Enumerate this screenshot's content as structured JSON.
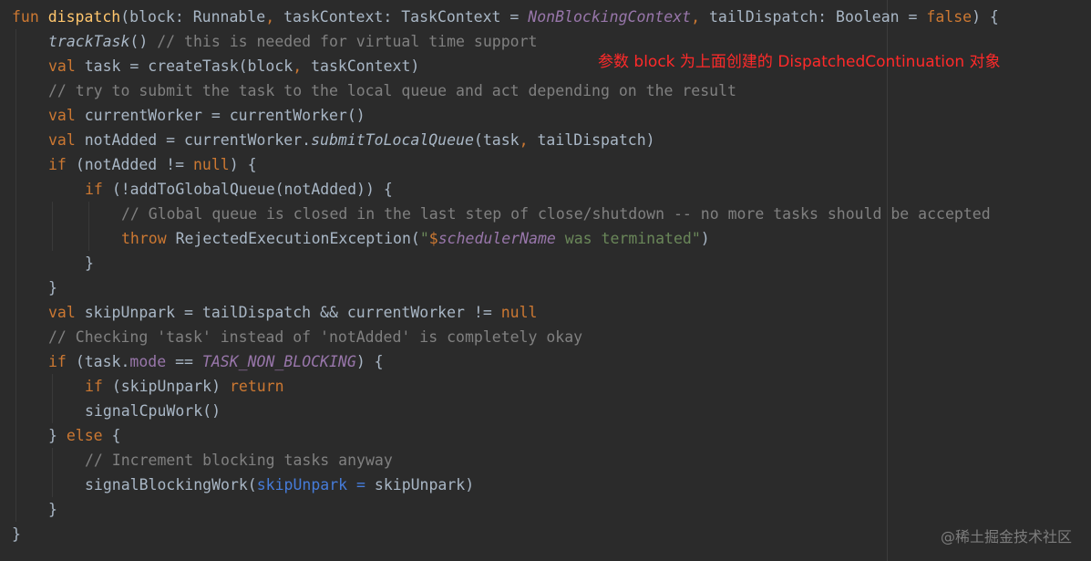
{
  "annotation": "参数 block 为上面创建的 DispatchedContinuation 对象",
  "watermark": "@稀土掘金技术社区",
  "colors": {
    "background": "#2b2b2b",
    "keyword": "#cc7832",
    "function_decl": "#ffc66d",
    "default_text": "#a9b7c6",
    "comment": "#808080",
    "string": "#6a8759",
    "static_constant": "#9876aa",
    "named_argument": "#467cda",
    "annotation_text": "#ff2a2a",
    "watermark": "#7d7d7d"
  },
  "code_lines": [
    {
      "indent": 0,
      "tokens": [
        {
          "t": "fun",
          "c": "kw"
        },
        {
          "t": " ",
          "c": "pl"
        },
        {
          "t": "dispatch",
          "c": "fn"
        },
        {
          "t": "(block: Runnable",
          "c": "pl"
        },
        {
          "t": ", ",
          "c": "kw"
        },
        {
          "t": "taskContext: TaskContext = ",
          "c": "pl"
        },
        {
          "t": "NonBlockingContext",
          "c": "st"
        },
        {
          "t": ", ",
          "c": "kw"
        },
        {
          "t": "tailDispatch: Boolean = ",
          "c": "pl"
        },
        {
          "t": "false",
          "c": "kw"
        },
        {
          "t": ") {",
          "c": "pl"
        }
      ]
    },
    {
      "indent": 1,
      "tokens": [
        {
          "t": "trackTask",
          "c": "it"
        },
        {
          "t": "() ",
          "c": "pl"
        },
        {
          "t": "// this is needed for virtual time support",
          "c": "cm"
        }
      ]
    },
    {
      "indent": 1,
      "tokens": [
        {
          "t": "val ",
          "c": "kw"
        },
        {
          "t": "task = createTask(block",
          "c": "pl"
        },
        {
          "t": ", ",
          "c": "kw"
        },
        {
          "t": "taskContext)",
          "c": "pl"
        }
      ]
    },
    {
      "indent": 1,
      "tokens": [
        {
          "t": "// try to submit the task to the local queue and act depending on the result",
          "c": "cm"
        }
      ]
    },
    {
      "indent": 1,
      "tokens": [
        {
          "t": "val ",
          "c": "kw"
        },
        {
          "t": "currentWorker = currentWorker()",
          "c": "pl"
        }
      ]
    },
    {
      "indent": 1,
      "tokens": [
        {
          "t": "val ",
          "c": "kw"
        },
        {
          "t": "notAdded = currentWorker.",
          "c": "pl"
        },
        {
          "t": "submitToLocalQueue",
          "c": "it"
        },
        {
          "t": "(task",
          "c": "pl"
        },
        {
          "t": ", ",
          "c": "kw"
        },
        {
          "t": "tailDispatch)",
          "c": "pl"
        }
      ]
    },
    {
      "indent": 1,
      "tokens": [
        {
          "t": "if ",
          "c": "kw"
        },
        {
          "t": "(notAdded != ",
          "c": "pl"
        },
        {
          "t": "null",
          "c": "kw"
        },
        {
          "t": ") {",
          "c": "pl"
        }
      ]
    },
    {
      "indent": 2,
      "tokens": [
        {
          "t": "if ",
          "c": "kw"
        },
        {
          "t": "(!addToGlobalQueue(notAdded)) {",
          "c": "pl"
        }
      ]
    },
    {
      "indent": 3,
      "tokens": [
        {
          "t": "// Global queue is closed in the last step of close/shutdown -- no more tasks should be accepted",
          "c": "cm"
        }
      ]
    },
    {
      "indent": 3,
      "tokens": [
        {
          "t": "throw ",
          "c": "kw"
        },
        {
          "t": "RejectedExecutionException(",
          "c": "pl"
        },
        {
          "t": "\"",
          "c": "sg"
        },
        {
          "t": "$",
          "c": "kw"
        },
        {
          "t": "schedulerName",
          "c": "st"
        },
        {
          "t": " was terminated\"",
          "c": "sg"
        },
        {
          "t": ")",
          "c": "pl"
        }
      ]
    },
    {
      "indent": 2,
      "tokens": [
        {
          "t": "}",
          "c": "pl"
        }
      ]
    },
    {
      "indent": 1,
      "tokens": [
        {
          "t": "}",
          "c": "pl"
        }
      ]
    },
    {
      "indent": 1,
      "tokens": [
        {
          "t": "val ",
          "c": "kw"
        },
        {
          "t": "skipUnpark = tailDispatch && currentWorker != ",
          "c": "pl"
        },
        {
          "t": "null",
          "c": "kw"
        }
      ]
    },
    {
      "indent": 1,
      "tokens": [
        {
          "t": "// Checking 'task' instead of 'notAdded' is completely okay",
          "c": "cm"
        }
      ]
    },
    {
      "indent": 1,
      "tokens": [
        {
          "t": "if ",
          "c": "kw"
        },
        {
          "t": "(task.",
          "c": "pl"
        },
        {
          "t": "mode",
          "c": "st2"
        },
        {
          "t": " == ",
          "c": "pl"
        },
        {
          "t": "TASK_NON_BLOCKING",
          "c": "st"
        },
        {
          "t": ") {",
          "c": "pl"
        }
      ]
    },
    {
      "indent": 2,
      "tokens": [
        {
          "t": "if ",
          "c": "kw"
        },
        {
          "t": "(skipUnpark) ",
          "c": "pl"
        },
        {
          "t": "return",
          "c": "kw"
        }
      ]
    },
    {
      "indent": 2,
      "tokens": [
        {
          "t": "signalCpuWork()",
          "c": "pl"
        }
      ]
    },
    {
      "indent": 1,
      "tokens": [
        {
          "t": "} ",
          "c": "pl"
        },
        {
          "t": "else ",
          "c": "kw"
        },
        {
          "t": "{",
          "c": "pl"
        }
      ]
    },
    {
      "indent": 2,
      "tokens": [
        {
          "t": "// Increment blocking tasks anyway",
          "c": "cm"
        }
      ]
    },
    {
      "indent": 2,
      "tokens": [
        {
          "t": "signalBlockingWork(",
          "c": "pl"
        },
        {
          "t": "skipUnpark = ",
          "c": "na"
        },
        {
          "t": "skipUnpark)",
          "c": "pl"
        }
      ]
    },
    {
      "indent": 1,
      "tokens": [
        {
          "t": "}",
          "c": "pl"
        }
      ]
    },
    {
      "indent": 0,
      "tokens": [
        {
          "t": "}",
          "c": "pl"
        }
      ]
    }
  ]
}
